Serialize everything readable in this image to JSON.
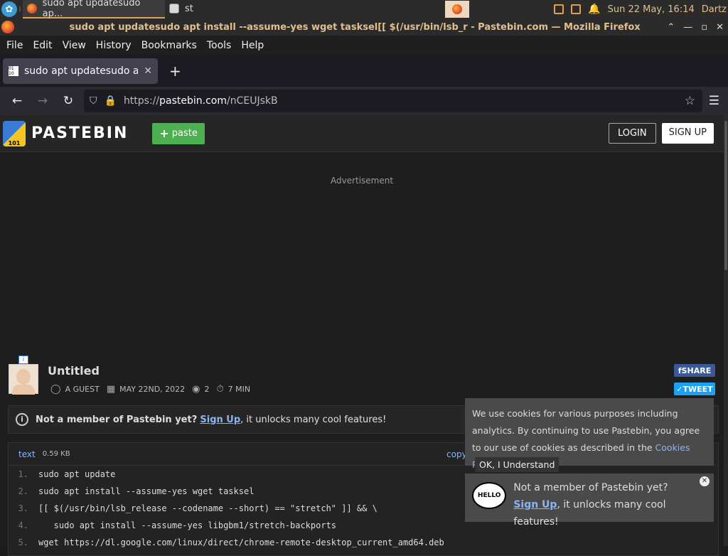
{
  "taskbar": {
    "windows": [
      {
        "label": "sudo apt updatesudo ap..."
      },
      {
        "label": "st"
      }
    ],
    "clock": "Sun 22 May, 16:14",
    "user": "Dartz"
  },
  "window": {
    "title": "sudo apt updatesudo apt install --assume-yes wget tasksel[[ $(/usr/bin/lsb_r - Pastebin.com — Mozilla Firefox"
  },
  "menu": [
    "File",
    "Edit",
    "View",
    "History",
    "Bookmarks",
    "Tools",
    "Help"
  ],
  "tab": {
    "label": "sudo apt updatesudo apt"
  },
  "url": {
    "prefix": "https://",
    "domain": "pastebin.com",
    "path": "/nCEUJskB"
  },
  "pastebin": {
    "logo": "PASTEBIN",
    "paste_button": "paste",
    "login": "LOGIN",
    "signup": "SIGN UP",
    "advertisement": "Advertisement"
  },
  "post": {
    "title": "Untitled",
    "author": "A GUEST",
    "date": "MAY 22ND, 2022",
    "views": "2",
    "expiry": "7 MIN",
    "share": "SHARE",
    "tweet": "TWEET"
  },
  "notice": {
    "bold": "Not a member of Pastebin yet?",
    "link": "Sign Up",
    "rest": ", it unlocks many cool features!"
  },
  "code": {
    "type": "text",
    "size": "0.59 KB",
    "copy": "copy",
    "lines": [
      {
        "n": "1.",
        "t": "sudo apt update"
      },
      {
        "n": "2.",
        "t": "sudo apt install --assume-yes wget tasksel"
      },
      {
        "n": "3.",
        "t": "[[ $(/usr/bin/lsb_release --codename --short) == \"stretch\" ]] && \\"
      },
      {
        "n": "4.",
        "t": "   sudo apt install --assume-yes libgbm1/stretch-backports"
      },
      {
        "n": "5.",
        "t": "wget https://dl.google.com/linux/direct/chrome-remote-desktop_current_amd64.deb"
      }
    ]
  },
  "cookie": {
    "text": "We use cookies for various purposes including analytics. By continuing to use Pastebin, you agree to our use of cookies as described in the ",
    "link": "Cookies Policy",
    "end": ".",
    "ok": "OK, I Understand"
  },
  "promo": {
    "hello": "HELLO",
    "line1": "Not a member of Pastebin yet?",
    "link": "Sign Up",
    "rest": ", it unlocks many cool features!"
  }
}
